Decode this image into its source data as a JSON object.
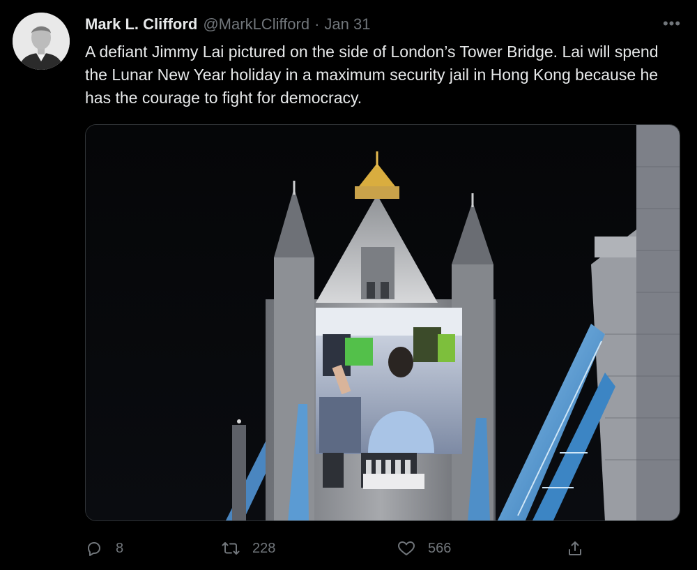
{
  "tweet": {
    "author_name": "Mark L. Clifford",
    "handle": "@MarkLClifford",
    "separator": "·",
    "date": "Jan 31",
    "text": "A defiant Jimmy Lai pictured on the side of London’s Tower Bridge. Lai will spend the Lunar New Year holiday in a maximum security jail in Hong Kong because he has the courage to fight for democracy.",
    "more_label": "•••"
  },
  "actions": {
    "replies": "8",
    "retweets": "228",
    "likes": "566"
  },
  "icons": {
    "reply": "reply-icon",
    "retweet": "retweet-icon",
    "like": "heart-icon",
    "share": "share-icon",
    "more": "more-icon"
  },
  "colors": {
    "background": "#000000",
    "text": "#e7e9ea",
    "secondary": "#71767b",
    "border": "#2f3336"
  }
}
